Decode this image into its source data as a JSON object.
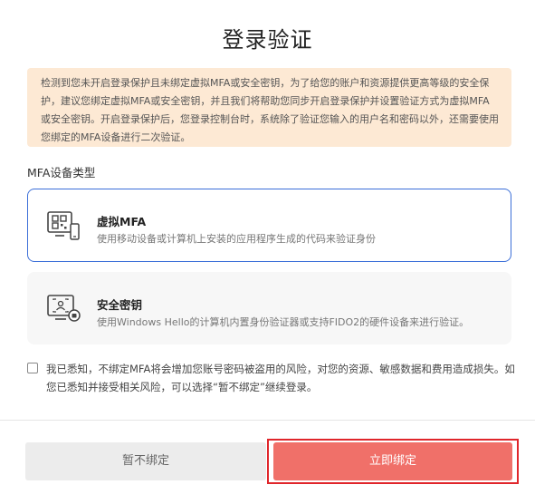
{
  "title": "登录验证",
  "notice": "检测到您未开启登录保护且未绑定虚拟MFA或安全密钥，为了给您的账户和资源提供更高等级的安全保护，建议您绑定虚拟MFA或安全密钥，并且我们将帮助您同步开启登录保护并设置验证方式为虚拟MFA或安全密钥。开启登录保护后，您登录控制台时，系统除了验证您输入的用户名和密码以外，还需要使用您绑定的MFA设备进行二次验证。",
  "section_label": "MFA设备类型",
  "options": [
    {
      "name": "虚拟MFA",
      "desc": "使用移动设备或计算机上安装的应用程序生成的代码来验证身份",
      "icon": "qr-device-icon",
      "selected": true
    },
    {
      "name": "安全密钥",
      "desc": "使用Windows Hello的计算机内置身份验证器或支持FIDO2的硬件设备来进行验证。",
      "icon": "security-key-icon",
      "selected": false
    }
  ],
  "acknowledge": {
    "checked": false,
    "text": "我已悉知，不绑定MFA将会增加您账号密码被盗用的风险，对您的资源、敏感数据和费用造成损失。如您已悉知并接受相关风险，可以选择“暂不绑定”继续登录。"
  },
  "buttons": {
    "skip": "暂不绑定",
    "bind": "立即绑定"
  },
  "colors": {
    "notice_bg": "#fde9d4",
    "selected_border": "#3b6fd8",
    "primary": "#f07069",
    "focus_ring": "#e0262b"
  }
}
